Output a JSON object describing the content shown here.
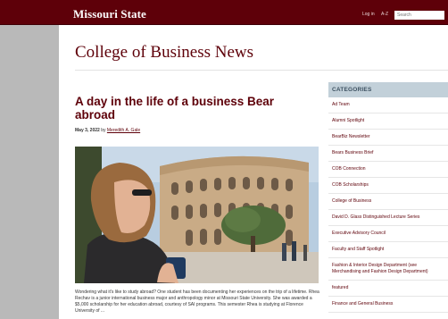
{
  "header": {
    "logo": "Missouri State",
    "login": "Log in",
    "az": "A-Z",
    "search_placeholder": "Search"
  },
  "site_title": "College of Business News",
  "article": {
    "title": "A day in the life of a business Bear abroad",
    "date": "May 3, 2022",
    "by": "by",
    "author": "Meredith A. Gale",
    "body": "Wondering what it's like to study abroad? One student has been documenting her experiences on the trip of a lifetime. Rhea Rechav is a junior international business major and anthropology minor at Missouri State University. She was awarded a $5,000 scholarship for her education abroad, courtesy of SAI programs. This semester Rhea is studying at Florence University of ..."
  },
  "sidebar": {
    "heading": "CATEGORIES",
    "items": [
      "Ad Team",
      "Alumni Spotlight",
      "BearBiz Newsletter",
      "Bears Business Brief",
      "COB Connection",
      "COB Scholarships",
      "College of Business",
      "David D. Glass Distinguished Lecture Series",
      "Executive Advisory Council",
      "Faculty and Staff Spotlight",
      "Fashion & Interior Design Department (see Merchandising and Fashion Design Department)",
      "featured",
      "Finance and General Business"
    ]
  }
}
